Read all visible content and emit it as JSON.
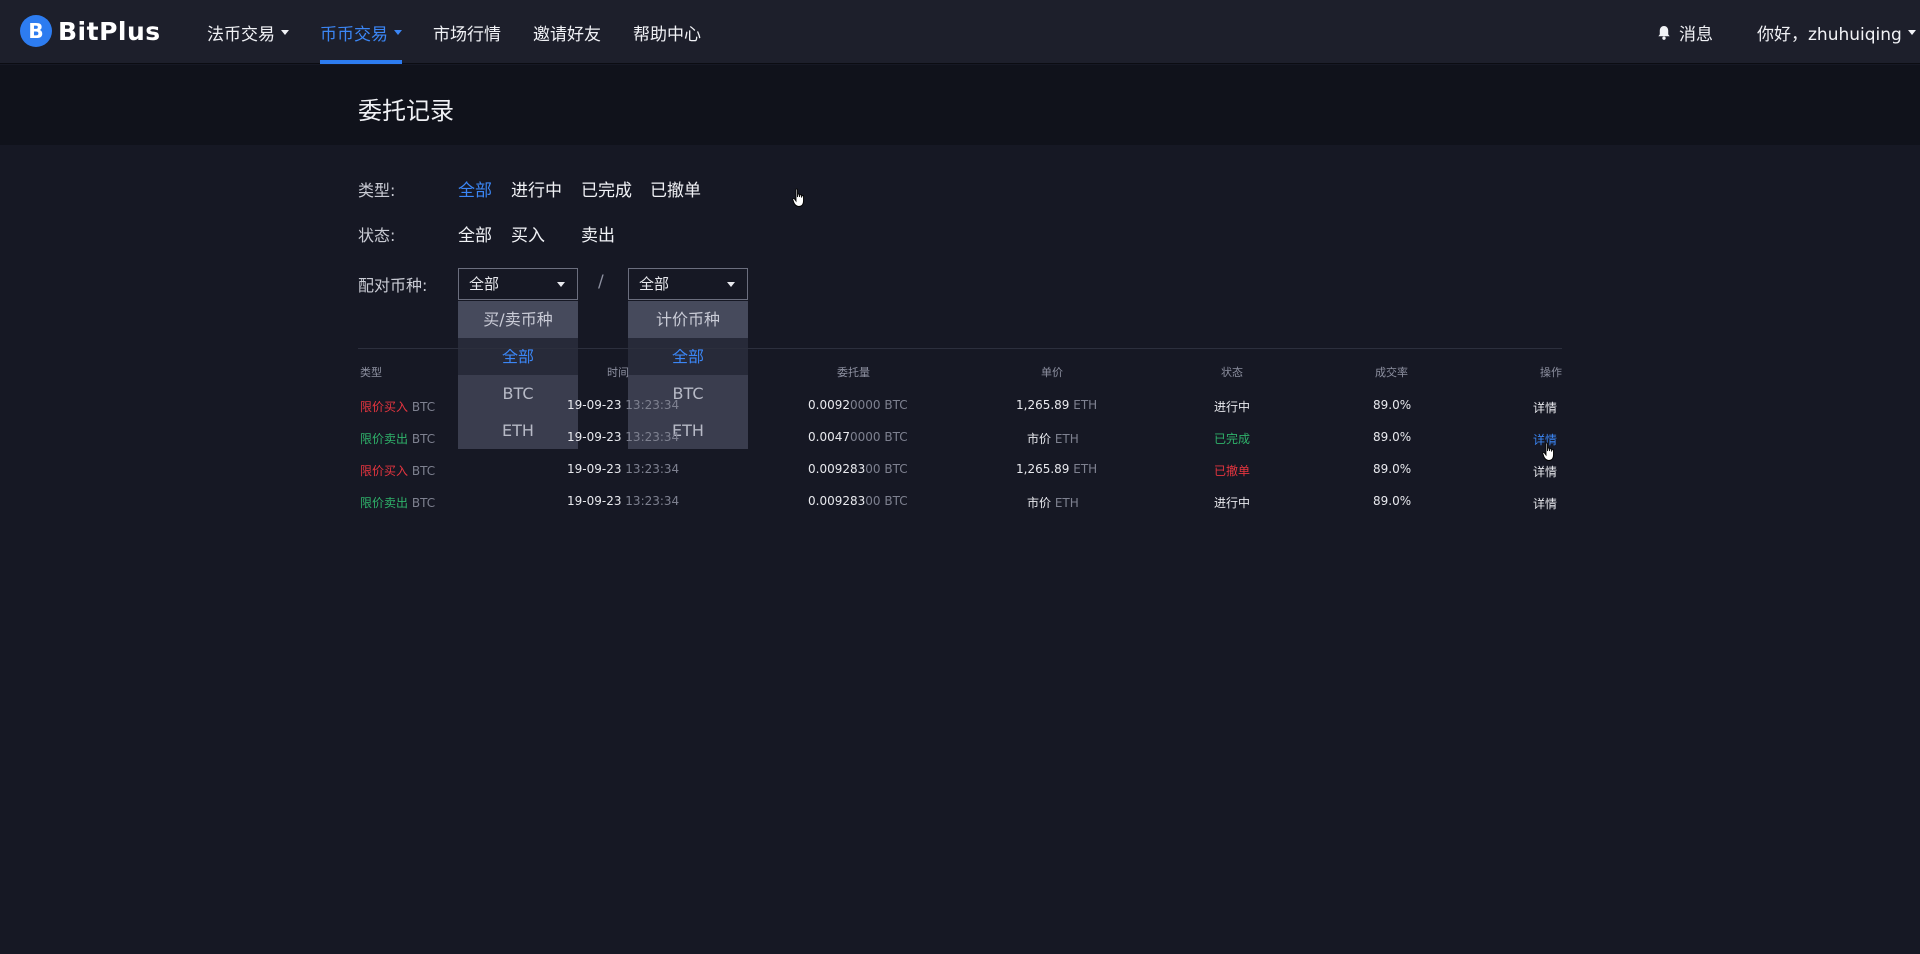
{
  "header": {
    "logo_letter": "B",
    "logo_text": "BitPlus",
    "nav": [
      {
        "label": "法币交易",
        "dropdown": true,
        "active": false
      },
      {
        "label": "币币交易",
        "dropdown": true,
        "active": true
      },
      {
        "label": "市场行情",
        "dropdown": false,
        "active": false
      },
      {
        "label": "邀请好友",
        "dropdown": false,
        "active": false
      },
      {
        "label": "帮助中心",
        "dropdown": false,
        "active": false
      }
    ],
    "messages_label": "消息",
    "greeting": "你好，zhuhuiqing"
  },
  "page": {
    "title": "委托记录"
  },
  "filters": {
    "type_label": "类型:",
    "type_options": [
      "全部",
      "进行中",
      "已完成",
      "已撤单"
    ],
    "status_label": "状态:",
    "status_options": [
      "全部",
      "买入",
      "卖出"
    ],
    "pair_label": "配对币种:",
    "base_select": {
      "value": "全部",
      "header": "买/卖币种",
      "options": [
        "全部",
        "BTC",
        "ETH"
      ],
      "selected": "全部"
    },
    "separator": "/",
    "quote_select": {
      "value": "全部",
      "header": "计价币种",
      "options": [
        "全部",
        "BTC",
        "ETH"
      ],
      "selected": "全部"
    }
  },
  "table": {
    "headers": [
      "类型",
      "时间",
      "委托量",
      "单价",
      "状态",
      "成交率",
      "操作"
    ],
    "rows": [
      {
        "type": "限价买入",
        "side": "buy",
        "coin": "BTC",
        "date": "19-09-23",
        "time": "13:23:34",
        "amt_main": "0.0092",
        "amt_dim": "0000 BTC",
        "price": "1,265.89",
        "price_unit": "ETH",
        "status": "进行中",
        "status_color": "normal",
        "rate": "89.0%",
        "action": "详情"
      },
      {
        "type": "限价卖出",
        "side": "sell",
        "coin": "BTC",
        "date": "19-09-23",
        "time": "13:23:34",
        "amt_main": "0.0047",
        "amt_dim": "0000 BTC",
        "price": "市价",
        "price_unit": "ETH",
        "status": "已完成",
        "status_color": "green",
        "rate": "89.0%",
        "action": "详情"
      },
      {
        "type": "限价买入",
        "side": "buy",
        "coin": "BTC",
        "date": "19-09-23",
        "time": "13:23:34",
        "amt_main": "0.009283",
        "amt_dim": "00 BTC",
        "price": "1,265.89",
        "price_unit": "ETH",
        "status": "已撤单",
        "status_color": "red",
        "rate": "89.0%",
        "action": "详情"
      },
      {
        "type": "限价卖出",
        "side": "sell",
        "coin": "BTC",
        "date": "19-09-23",
        "time": "13:23:34",
        "amt_main": "0.009283",
        "amt_dim": "00 BTC",
        "price": "市价",
        "price_unit": "ETH",
        "status": "进行中",
        "status_color": "normal",
        "rate": "89.0%",
        "action": "详情"
      }
    ]
  },
  "colors": {
    "accent": "#2d7cf0",
    "buy": "#e5353f",
    "sell": "#2fb26a",
    "background": "#161824"
  }
}
